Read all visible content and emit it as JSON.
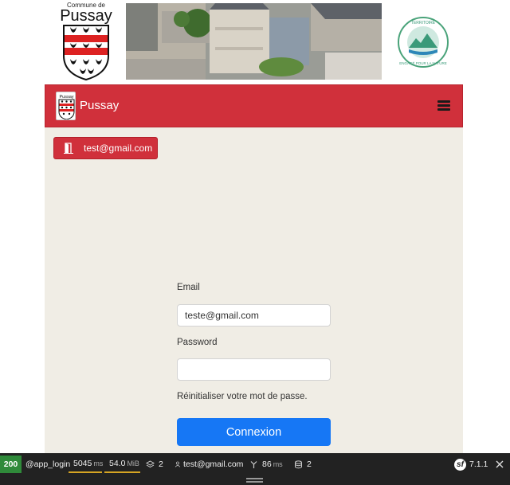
{
  "banner": {
    "commune_small": "Commune de",
    "commune_name": "Pussay",
    "territoire_text": "TERRITOIRE ENGAGÉ POUR LA NATURE"
  },
  "navbar": {
    "brand_icon_text": "Pussay",
    "brand": "Pussay",
    "color": "#d0303b"
  },
  "user_button": {
    "email": "test@gmail.com"
  },
  "login_form": {
    "email_label": "Email",
    "email_value": "teste@gmail.com",
    "password_label": "Password",
    "password_value": "",
    "reset_link": "Réinitialiser votre mot de passe.",
    "submit_label": "Connexion",
    "submit_color": "#1677f5"
  },
  "debug_toolbar": {
    "status_code": "200",
    "route": "@app_login",
    "time_value": "5045",
    "time_unit": "ms",
    "memory_value": "54.0",
    "memory_unit": "MiB",
    "layers_count": "2",
    "user": "test@gmail.com",
    "ajax_value": "86",
    "ajax_unit": "ms",
    "db_count": "2",
    "version": "7.1.1"
  }
}
